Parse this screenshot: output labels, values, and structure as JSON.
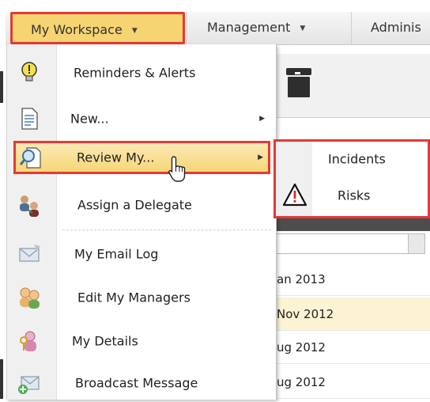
{
  "menubar": {
    "tabs": [
      {
        "label": "My Workspace"
      },
      {
        "label": "Management"
      },
      {
        "label": "Adminis"
      }
    ]
  },
  "dropdown": {
    "items": [
      {
        "label": "Reminders & Alerts",
        "icon": "alert-bulb-icon"
      },
      {
        "label": "New...",
        "icon": "new-document-icon",
        "has_submenu": true
      },
      {
        "label": "Review My...",
        "icon": "review-magnifier-icon",
        "has_submenu": true,
        "active": true
      },
      {
        "label": "Assign a Delegate",
        "icon": "delegate-users-icon"
      },
      {
        "label": "My Email Log",
        "icon": "email-icon"
      },
      {
        "label": "Edit My Managers",
        "icon": "managers-icon"
      },
      {
        "label": "My Details",
        "icon": "user-details-icon"
      },
      {
        "label": "Broadcast Message",
        "icon": "broadcast-message-icon"
      }
    ]
  },
  "submenu": {
    "items": [
      {
        "label": "Incidents"
      },
      {
        "label": "Risks",
        "icon": "warning-triangle-icon"
      }
    ]
  },
  "background_rows": [
    {
      "text": "an 2013"
    },
    {
      "text": "Nov 2012"
    },
    {
      "text": "ug 2012"
    },
    {
      "text": "ug 2012"
    }
  ],
  "colors": {
    "highlight_border": "#e53935",
    "active_fill": "#f6d777",
    "row_highlight": "#fbf3d3"
  }
}
